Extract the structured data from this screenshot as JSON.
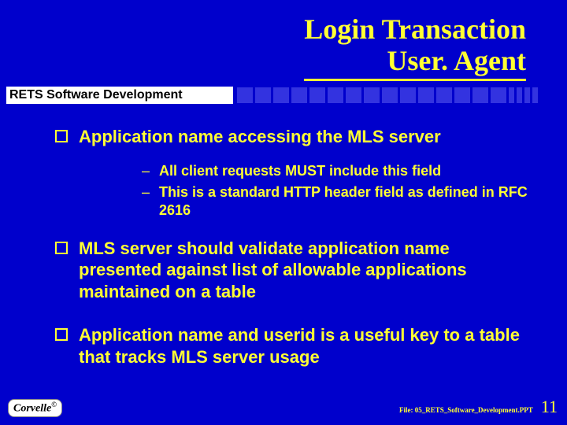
{
  "title_line1": "Login Transaction",
  "title_line2": "User. Agent",
  "deck_label": "RETS Software Development",
  "bullets": [
    {
      "text": "Application name accessing the MLS server",
      "subs": [
        "All client requests MUST include this field",
        "This is a standard HTTP header field as defined in RFC 2616"
      ]
    },
    {
      "text": "MLS server should validate application name presented against list of allowable applications maintained on a table",
      "subs": []
    },
    {
      "text": "Application name and userid is a useful key to a table that tracks MLS server usage",
      "subs": []
    }
  ],
  "logo_text": "Corvelle",
  "file_label": "File: 05_RETS_Software_Development.PPT",
  "page_number": "11"
}
